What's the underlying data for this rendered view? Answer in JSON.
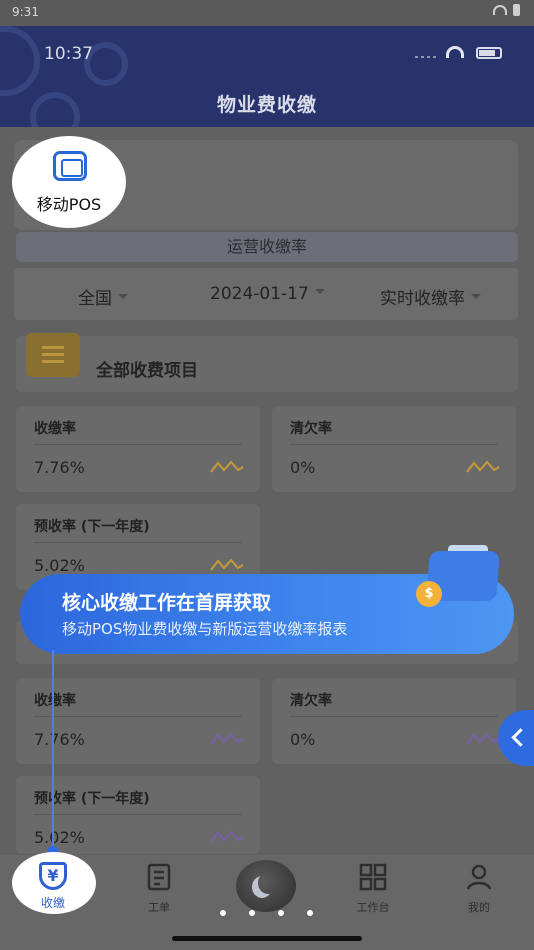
{
  "sys_status": {
    "time": "9:31"
  },
  "header": {
    "clock": "10:37",
    "title": "物业费收缴"
  },
  "quick_entry": {
    "label": "移动POS"
  },
  "rate_section": {
    "title": "运营收缴率"
  },
  "filters": {
    "region": "全国",
    "date": "2024-01-17",
    "metric": "实时收缴率"
  },
  "project": {
    "label": "全部收费项目"
  },
  "group1": {
    "collection_rate": {
      "label": "收缴率",
      "value": "7.76%"
    },
    "arrears_rate": {
      "label": "清欠率",
      "value": "0%"
    },
    "prepaid_rate": {
      "label": "预收率 (下一年度)",
      "value": "5.02%"
    }
  },
  "group2": {
    "collection_rate": {
      "label": "收缴率",
      "value": "7.76%"
    },
    "arrears_rate": {
      "label": "清欠率",
      "value": "0%"
    },
    "prepaid_rate": {
      "label": "预收率 (下一年度)",
      "value": "5.02%"
    }
  },
  "guide": {
    "headline": "核心收缴工作在首屏获取",
    "subline": "移动POS物业费收缴与新版运营收缴率报表",
    "coin_symbol": "$"
  },
  "tabbar": {
    "items": [
      {
        "label": "收缴",
        "icon": "yuan-shield-icon",
        "glyph": "¥"
      },
      {
        "label": "工单",
        "icon": "work-order-icon"
      },
      {
        "label": "",
        "icon": "moon-icon"
      },
      {
        "label": "工作台",
        "icon": "grid-icon"
      },
      {
        "label": "我的",
        "icon": "user-icon"
      }
    ]
  },
  "colors": {
    "accent": "#2f6be0",
    "spark_gold": "#c79a3a",
    "spark_purple": "#7b5fa8",
    "header_bg": "#28336b"
  }
}
